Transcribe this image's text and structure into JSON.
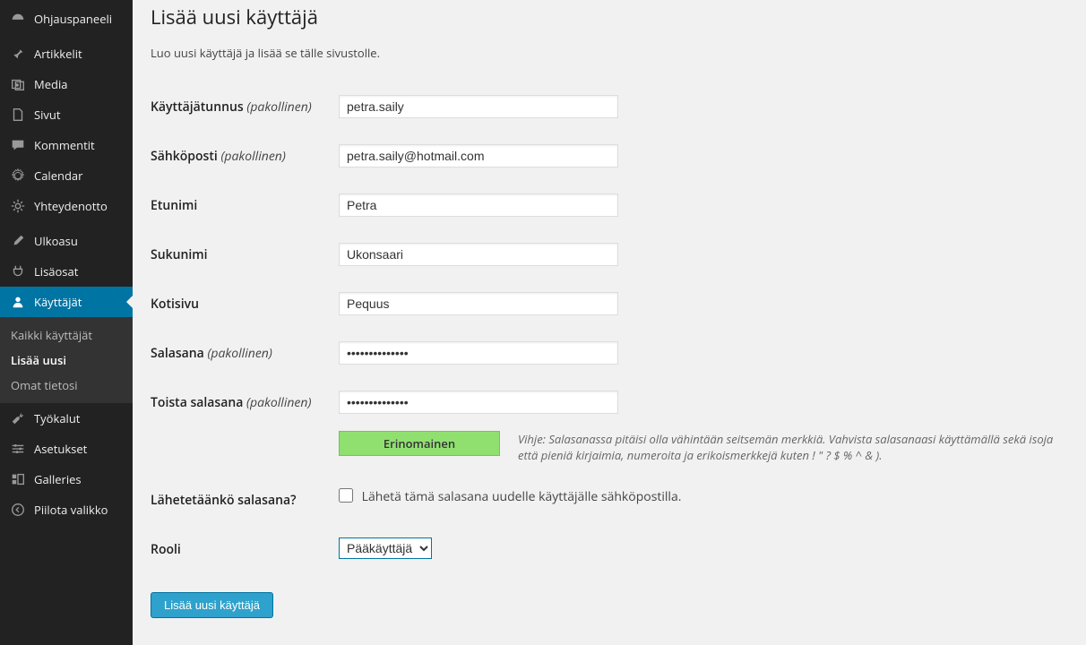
{
  "sidebar": {
    "items": [
      {
        "label": "Ohjauspaneeli",
        "icon": "dashboard"
      },
      {
        "label": "Artikkelit",
        "icon": "pin"
      },
      {
        "label": "Media",
        "icon": "media"
      },
      {
        "label": "Sivut",
        "icon": "page"
      },
      {
        "label": "Kommentit",
        "icon": "comment"
      },
      {
        "label": "Calendar",
        "icon": "gear"
      },
      {
        "label": "Yhteydenotto",
        "icon": "gear"
      },
      {
        "label": "Ulkoasu",
        "icon": "brush"
      },
      {
        "label": "Lisäosat",
        "icon": "plug"
      },
      {
        "label": "Käyttäjät",
        "icon": "user",
        "active": true
      },
      {
        "label": "Työkalut",
        "icon": "wrench"
      },
      {
        "label": "Asetukset",
        "icon": "sliders"
      },
      {
        "label": "Galleries",
        "icon": "gallery"
      },
      {
        "label": "Piilota valikko",
        "icon": "collapse"
      }
    ],
    "submenu": [
      {
        "label": "Kaikki käyttäjät"
      },
      {
        "label": "Lisää uusi",
        "current": true
      },
      {
        "label": "Omat tietosi"
      }
    ]
  },
  "page": {
    "title": "Lisää uusi käyttäjä",
    "subtitle": "Luo uusi käyttäjä ja lisää se tälle sivustolle.",
    "required_suffix": "(pakollinen)"
  },
  "fields": {
    "username": {
      "label": "Käyttäjätunnus",
      "value": "petra.saily",
      "required": true
    },
    "email": {
      "label": "Sähköposti",
      "value": "petra.saily@hotmail.com",
      "required": true
    },
    "first": {
      "label": "Etunimi",
      "value": "Petra"
    },
    "last": {
      "label": "Sukunimi",
      "value": "Ukonsaari"
    },
    "website": {
      "label": "Kotisivu",
      "value": "Pequus"
    },
    "password": {
      "label": "Salasana",
      "value": "••••••••••••••",
      "required": true
    },
    "password2": {
      "label": "Toista salasana",
      "value": "••••••••••••••",
      "required": true
    },
    "strength": {
      "label": "Erinomainen"
    },
    "hint": "Vihje: Salasanassa pitäisi olla vähintään seitsemän merkkiä. Vahvista salasanaasi käyttämällä sekä isoja että pieniä kirjaimia, numeroita ja erikoismerkkejä kuten ! \" ? $ % ^ & ).",
    "sendpw": {
      "label": "Lähetetäänkö salasana?",
      "checkbox_label": "Lähetä tämä salasana uudelle käyttäjälle sähköpostilla."
    },
    "role": {
      "label": "Rooli",
      "value": "Pääkäyttäjä"
    }
  },
  "submit": {
    "label": "Lisää uusi käyttäjä"
  }
}
